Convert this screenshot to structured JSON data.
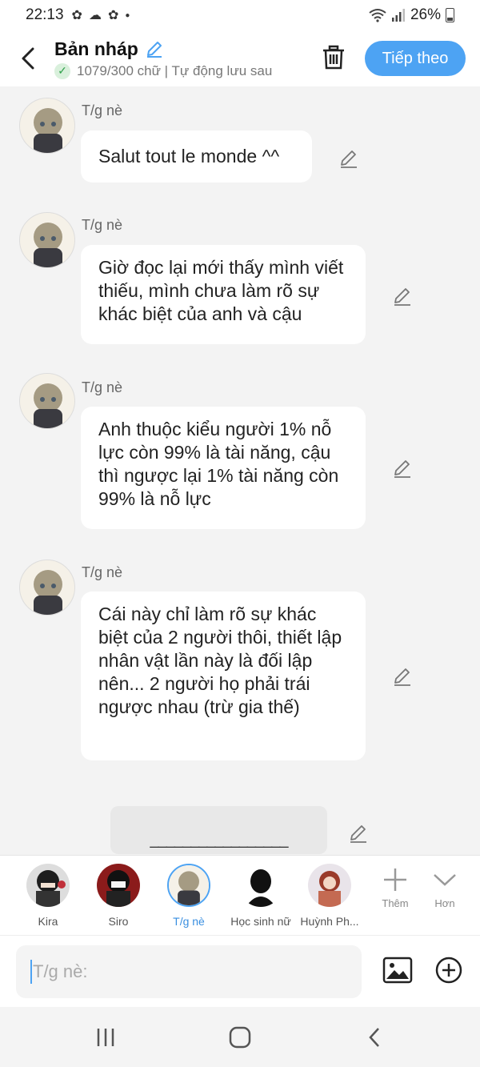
{
  "status": {
    "time": "22:13",
    "battery": "26%",
    "notification_icons": [
      "paw-icon",
      "cloud-icon",
      "paw-icon",
      "dot-icon"
    ]
  },
  "header": {
    "title": "Bản nháp",
    "subtitle": "1079/300 chữ | Tự động lưu sau",
    "next_label": "Tiếp theo"
  },
  "messages": [
    {
      "sender": "T/g nè",
      "text": "Salut tout le monde ^^"
    },
    {
      "sender": "T/g nè",
      "text": "Giờ đọc lại mới thấy mình viết thiếu, mình chưa làm rõ sự khác biệt của anh và cậu"
    },
    {
      "sender": "T/g nè",
      "text": "Anh thuộc kiểu người 1% nỗ lực còn 99% là tài năng, cậu thì ngược lại 1% tài năng còn 99% là nỗ lực"
    },
    {
      "sender": "T/g nè",
      "text": "Cái này chỉ làm rõ sự khác biệt của 2 người thôi, thiết lập nhân vật lần này là đối lập nên... 2 người họ phải trái ngược nhau (trừ gia thế)"
    }
  ],
  "draft_line": "_________________",
  "characters": [
    {
      "name": "Kira"
    },
    {
      "name": "Siro"
    },
    {
      "name": "T/g nè"
    },
    {
      "name": "Học sinh nữ"
    },
    {
      "name": "Huỳnh Ph..."
    }
  ],
  "tools": {
    "add_label": "Thêm",
    "more_label": "Hơn"
  },
  "input": {
    "placeholder": "T/g nè:"
  },
  "accent_color": "#4da3f3"
}
